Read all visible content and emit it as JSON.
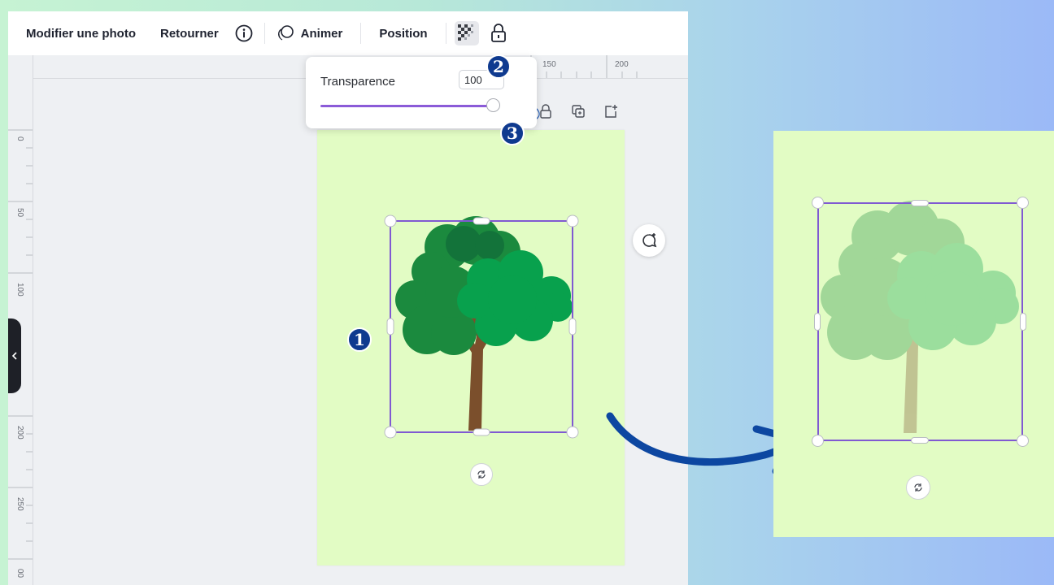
{
  "toolbar": {
    "edit_photo": "Modifier une photo",
    "flip": "Retourner",
    "info_icon": "info-icon",
    "animate": "Animer",
    "position": "Position",
    "transparency_icon": "checkerboard-icon",
    "lock_icon": "lock-icon"
  },
  "ruler": {
    "top_ticks": [
      "150",
      "200"
    ],
    "left_ticks": [
      "0",
      "50",
      "100",
      "200",
      "250",
      "00"
    ]
  },
  "transparency_popover": {
    "label": "Transparence",
    "value": "100",
    "slider_percent": 100
  },
  "annotations": {
    "step1": "1",
    "step2": "2",
    "step3": "3"
  },
  "colors": {
    "page": "#e2fcc4",
    "selection": "#8059d2",
    "badge": "#0f3a8f",
    "arrow": "#0d47a1",
    "tree_dark": "#1b8a3e",
    "tree_light": "#08a14d",
    "trunk": "#7b4f2c"
  },
  "result_opacity_note_icon": "rotate-icon"
}
